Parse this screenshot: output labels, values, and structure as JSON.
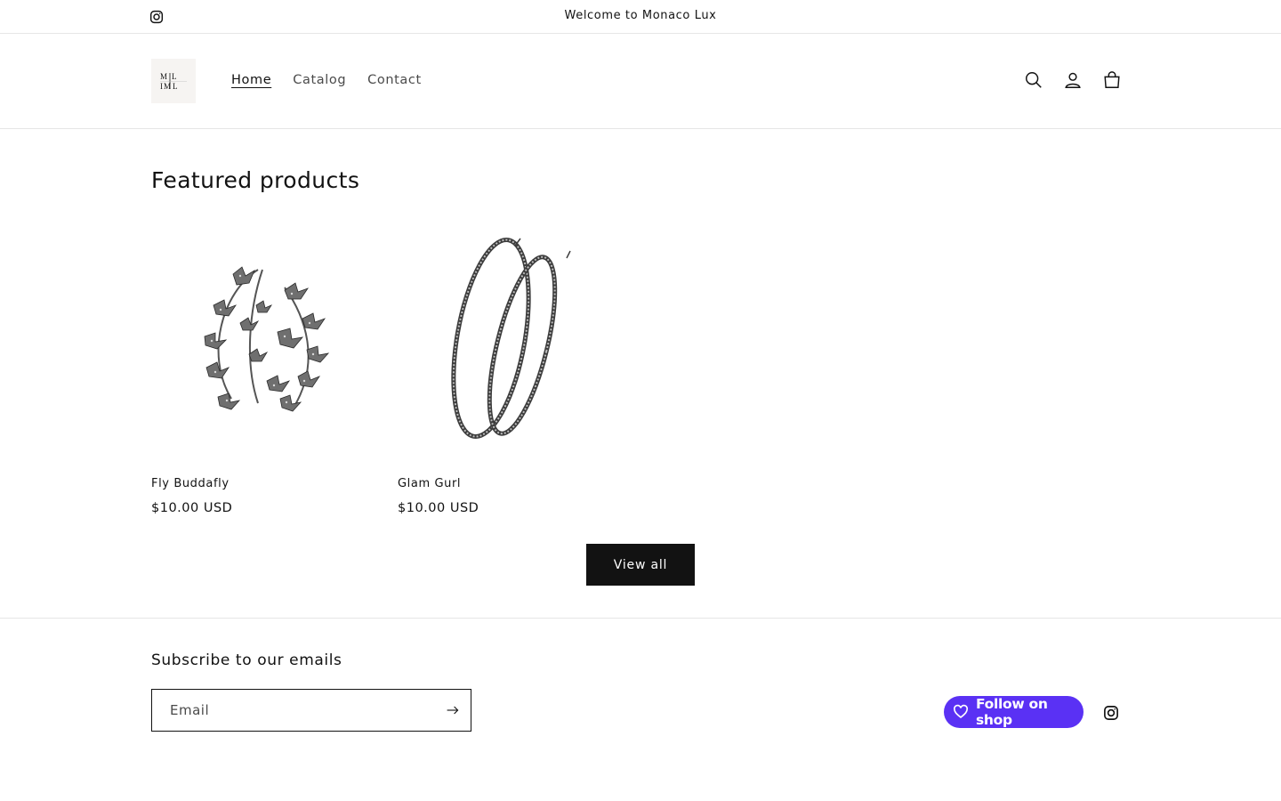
{
  "announcement": {
    "text": "Welcome to Monaco Lux",
    "social_icon": "instagram-icon"
  },
  "header": {
    "logo_alt": "ML",
    "nav": [
      {
        "label": "Home",
        "active": true
      },
      {
        "label": "Catalog",
        "active": false
      },
      {
        "label": "Contact",
        "active": false
      }
    ],
    "icons": [
      "search-icon",
      "account-icon",
      "cart-icon"
    ]
  },
  "featured": {
    "title": "Featured products",
    "products": [
      {
        "name": "Fly Buddafly",
        "price": "$10.00 USD",
        "image_icon": "butterfly-earrings-image"
      },
      {
        "name": "Glam Gurl",
        "price": "$10.00 USD",
        "image_icon": "hoop-earrings-image"
      }
    ],
    "view_all_label": "View all"
  },
  "footer": {
    "subscribe_title": "Subscribe to our emails",
    "email_placeholder": "Email",
    "follow_label": "Follow on shop",
    "social_icon": "instagram-icon"
  },
  "colors": {
    "accent": "#121212",
    "shop_purple": "#5a31f4",
    "border": "#e6e6e6"
  }
}
